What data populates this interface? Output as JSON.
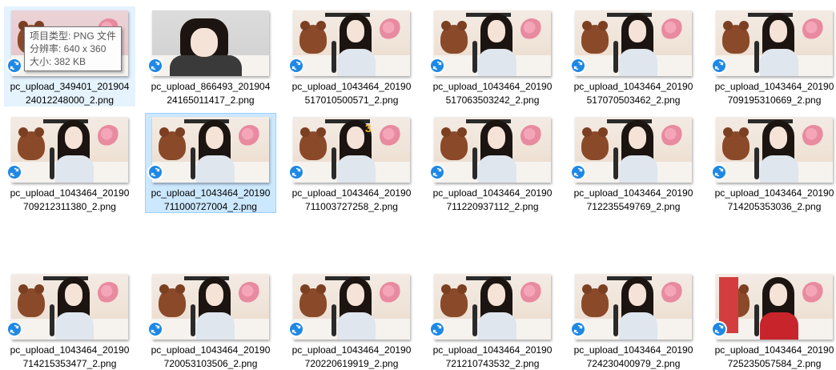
{
  "tooltip": {
    "lines": [
      "项目类型: PNG 文件",
      "分辨率: 640 x 360",
      "大小: 382 KB"
    ]
  },
  "files": [
    {
      "name_line1": "pc_upload_349401_201904",
      "name_line2": "24012248000_2.png",
      "thumb_variant": "v-pink",
      "overlay": ""
    },
    {
      "name_line1": "pc_upload_866493_201904",
      "name_line2": "24165011417_2.png",
      "thumb_variant": "v-room",
      "overlay": ""
    },
    {
      "name_line1": "pc_upload_1043464_20190",
      "name_line2": "517010500571_2.png",
      "thumb_variant": "",
      "overlay": ""
    },
    {
      "name_line1": "pc_upload_1043464_20190",
      "name_line2": "517063503242_2.png",
      "thumb_variant": "",
      "overlay": ""
    },
    {
      "name_line1": "pc_upload_1043464_20190",
      "name_line2": "517070503462_2.png",
      "thumb_variant": "",
      "overlay": ""
    },
    {
      "name_line1": "pc_upload_1043464_20190",
      "name_line2": "709195310669_2.png",
      "thumb_variant": "",
      "overlay": ""
    },
    {
      "name_line1": "pc_upload_1043464_20190",
      "name_line2": "709212311380_2.png",
      "thumb_variant": "",
      "overlay": ""
    },
    {
      "name_line1": "pc_upload_1043464_20190",
      "name_line2": "711000727004_2.png",
      "thumb_variant": "",
      "overlay": ""
    },
    {
      "name_line1": "pc_upload_1043464_20190",
      "name_line2": "711003727258_2.png",
      "thumb_variant": "",
      "overlay": "3"
    },
    {
      "name_line1": "pc_upload_1043464_20190",
      "name_line2": "711220937112_2.png",
      "thumb_variant": "",
      "overlay": ""
    },
    {
      "name_line1": "pc_upload_1043464_20190",
      "name_line2": "712235549769_2.png",
      "thumb_variant": "",
      "overlay": ""
    },
    {
      "name_line1": "pc_upload_1043464_20190",
      "name_line2": "714205353036_2.png",
      "thumb_variant": "",
      "overlay": ""
    },
    {
      "name_line1": "pc_upload_1043464_20190",
      "name_line2": "714215353477_2.png",
      "thumb_variant": "",
      "overlay": ""
    },
    {
      "name_line1": "pc_upload_1043464_20190",
      "name_line2": "720053103506_2.png",
      "thumb_variant": "",
      "overlay": ""
    },
    {
      "name_line1": "pc_upload_1043464_20190",
      "name_line2": "720220619919_2.png",
      "thumb_variant": "",
      "overlay": ""
    },
    {
      "name_line1": "pc_upload_1043464_20190",
      "name_line2": "721210743532_2.png",
      "thumb_variant": "",
      "overlay": ""
    },
    {
      "name_line1": "pc_upload_1043464_20190",
      "name_line2": "724230400979_2.png",
      "thumb_variant": "",
      "overlay": ""
    },
    {
      "name_line1": "pc_upload_1043464_20190",
      "name_line2": "725235057584_2.png",
      "thumb_variant": "v-red",
      "overlay": ""
    }
  ],
  "state": {
    "hovered_index": 0,
    "selected_index": 7
  },
  "colors": {
    "selected_bg": "#cce8ff",
    "hover_bg": "#e5f3ff",
    "sync_badge": "#1e88e5"
  },
  "icons": {
    "badge": "sync-icon"
  }
}
